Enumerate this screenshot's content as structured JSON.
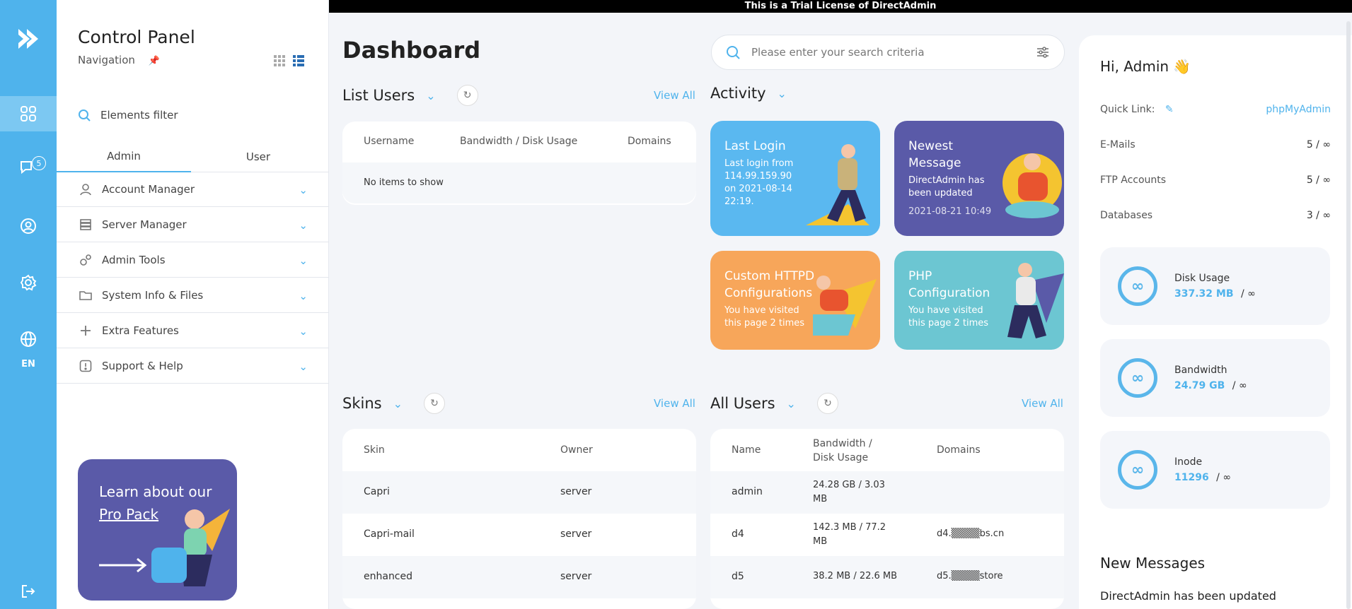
{
  "trial_banner": "This is a Trial License of DirectAdmin",
  "rail": {
    "badge_count": "5",
    "lang": "EN"
  },
  "sidebar": {
    "title": "Control Panel",
    "subtitle": "Navigation",
    "filter_placeholder": "Elements filter",
    "tabs": [
      "Admin",
      "User"
    ],
    "items": [
      {
        "label": "Account Manager",
        "icon": "user-icon"
      },
      {
        "label": "Server Manager",
        "icon": "server-icon"
      },
      {
        "label": "Admin Tools",
        "icon": "gears-icon"
      },
      {
        "label": "System Info & Files",
        "icon": "folder-icon"
      },
      {
        "label": "Extra Features",
        "icon": "plus-icon"
      },
      {
        "label": "Support & Help",
        "icon": "alert-icon"
      }
    ],
    "promo": {
      "line1": "Learn about our",
      "line2": "Pro Pack"
    }
  },
  "main": {
    "title": "Dashboard",
    "search_placeholder": "Please enter your search criteria",
    "list_users": {
      "title": "List Users",
      "view_all": "View All",
      "headers": [
        "Username",
        "Bandwidth / Disk Usage",
        "Domains"
      ],
      "empty": "No items to show"
    },
    "activity": {
      "title": "Activity",
      "cards": [
        {
          "title": "Last Login",
          "desc": "Last login from 114.99.159.90 on 2021-08-14 22:19.",
          "color": "#5ab8f0"
        },
        {
          "title": "Newest Message",
          "desc": "DirectAdmin has been updated",
          "date": "2021-08-21 10:49",
          "color": "#5a5aa8"
        },
        {
          "title": "Custom HTTPD Configurations",
          "desc": "You have visited this page 2 times",
          "color": "#f7a65a"
        },
        {
          "title": "PHP Configuration",
          "desc": "You have visited this page 2 times",
          "color": "#6cc6d2"
        }
      ]
    },
    "skins": {
      "title": "Skins",
      "view_all": "View All",
      "headers": [
        "Skin",
        "Owner"
      ],
      "rows": [
        [
          "Capri",
          "server"
        ],
        [
          "Capri-mail",
          "server"
        ],
        [
          "enhanced",
          "server"
        ]
      ]
    },
    "all_users": {
      "title": "All Users",
      "view_all": "View All",
      "headers": [
        "Name",
        "Bandwidth / Disk Usage",
        "Domains"
      ],
      "rows": [
        [
          "admin",
          "24.28 GB / 3.03 MB",
          ""
        ],
        [
          "d4",
          "142.3 MB / 77.2 MB",
          "d4.▒▒▒▒bs.cn"
        ],
        [
          "d5",
          "38.2 MB / 22.6 MB",
          "d5.▒▒▒▒store"
        ]
      ]
    }
  },
  "right": {
    "greeting": "Hi, Admin 👋",
    "quick_link_label": "Quick Link:",
    "quick_link": "phpMyAdmin",
    "stats": [
      {
        "label": "E-Mails",
        "value": "5 / ∞"
      },
      {
        "label": "FTP Accounts",
        "value": "5 / ∞"
      },
      {
        "label": "Databases",
        "value": "3 / ∞"
      }
    ],
    "usage": [
      {
        "label": "Disk Usage",
        "value": "337.32 MB",
        "limit": "/  ∞"
      },
      {
        "label": "Bandwidth",
        "value": "24.79 GB",
        "limit": "/  ∞"
      },
      {
        "label": "Inode",
        "value": "11296",
        "limit": "/  ∞"
      }
    ],
    "inf_symbol": "∞",
    "new_messages_title": "New Messages",
    "message": "DirectAdmin has been updated"
  }
}
